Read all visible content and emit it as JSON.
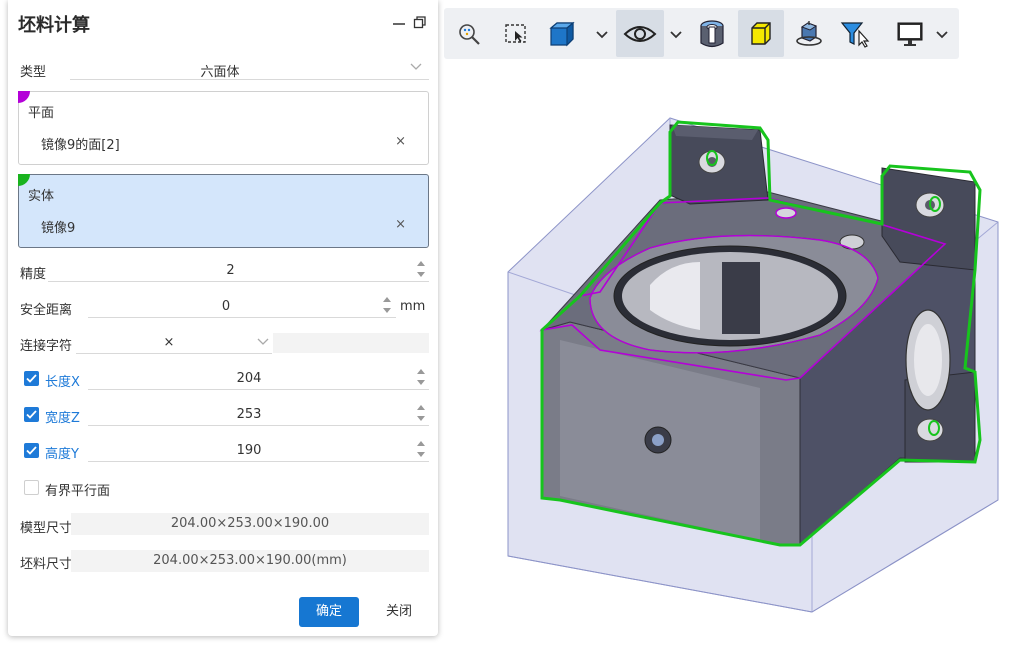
{
  "dialog": {
    "title": "坯料计算",
    "type_label": "类型",
    "type_value": "六面体",
    "plane_box": {
      "title": "平面",
      "item": "镜像9的面[2]",
      "remove": "×",
      "color": "#b400d8"
    },
    "solid_box": {
      "title": "实体",
      "item": "镜像9",
      "remove": "×",
      "color": "#19b31e"
    },
    "precision_label": "精度",
    "precision_value": "2",
    "safe_distance_label": "安全距离",
    "safe_distance_value": "0",
    "safe_distance_unit": "mm",
    "connector_label": "连接字符",
    "connector_value": "×",
    "length": {
      "label": "长度X",
      "value": "204",
      "checked": true
    },
    "width": {
      "label": "宽度Z",
      "value": "253",
      "checked": true
    },
    "height": {
      "label": "高度Y",
      "value": "190",
      "checked": true
    },
    "bounded_parallel": {
      "label": "有界平行面",
      "checked": false
    },
    "model_size_label": "模型尺寸",
    "model_size_value": "204.00×253.00×190.00",
    "blank_size_label": "坯料尺寸",
    "blank_size_value": "204.00×253.00×190.00(mm)",
    "ok_label": "确定",
    "close_label": "关闭"
  },
  "toolbar": {
    "items": [
      {
        "icon": "zoom-fit-icon"
      },
      {
        "icon": "zoom-window-icon"
      },
      {
        "icon": "view-cube-icon"
      },
      {
        "icon": "visibility-eye-icon"
      },
      {
        "icon": "section-view-icon"
      },
      {
        "icon": "shaded-face-icon"
      },
      {
        "icon": "rotate-view-icon"
      },
      {
        "icon": "selection-filter-icon"
      },
      {
        "icon": "display-monitor-icon"
      }
    ]
  },
  "colors": {
    "accent": "#1677d2",
    "plane_highlight": "#b400d8",
    "solid_highlight": "#19b31e",
    "blank_box": "#8d94c8"
  }
}
